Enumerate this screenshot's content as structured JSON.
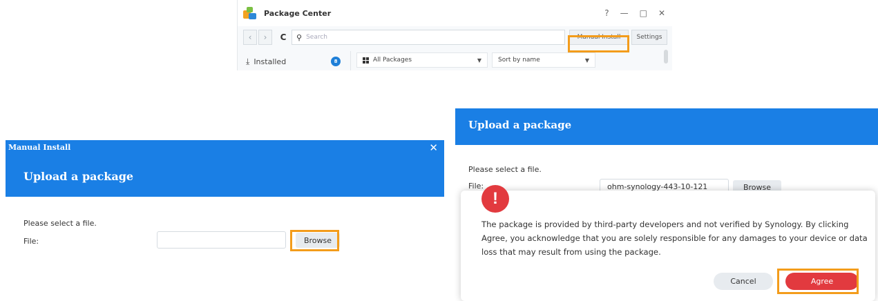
{
  "package_center": {
    "title": "Package Center",
    "window_controls": [
      "?",
      "—",
      "□",
      "✕"
    ],
    "search_placeholder": "Search",
    "manual_install_label": "Manual Install",
    "settings_label": "Settings",
    "sidebar_installed_label": "Installed",
    "installed_count": "8",
    "category_filter": "All Packages",
    "sort_filter": "Sort by name"
  },
  "manual_install_dialog": {
    "window_title": "Manual Install",
    "heading": "Upload a package",
    "prompt": "Please select a file.",
    "file_label": "File:",
    "file_value": "",
    "browse_label": "Browse"
  },
  "agree_dialog": {
    "heading": "Upload a package",
    "prompt": "Please select a file.",
    "file_label": "File:",
    "file_value": "ohm-synology-443-10-121",
    "browse_label": "Browse",
    "warning_icon": "!",
    "warning_text": "The package is provided by third-party developers and not verified by Synology. By clicking Agree, you acknowledge that you are solely responsible for any damages to your device or data loss that may result from using the package.",
    "cancel_label": "Cancel",
    "agree_label": "Agree"
  },
  "colors": {
    "header_blue": "#1a7fe5",
    "highlight_orange": "#f39c1b",
    "danger_red": "#e23a3f"
  }
}
